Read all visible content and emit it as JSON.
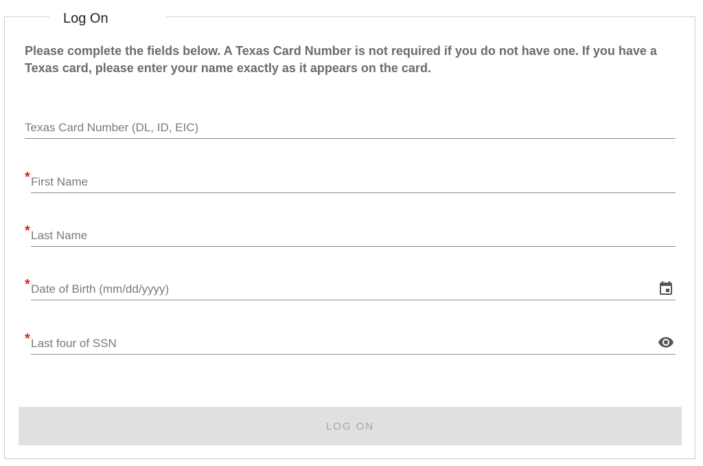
{
  "form": {
    "title": "Log On",
    "intro": "Please complete the fields below. A Texas Card Number is not required if you do not have one. If you have a Texas card, please enter your name exactly as it appears on the card.",
    "required_marker": "*",
    "fields": {
      "card": {
        "placeholder": "Texas Card Number (DL, ID, EIC)",
        "value": ""
      },
      "first_name": {
        "placeholder": "First Name",
        "value": ""
      },
      "last_name": {
        "placeholder": "Last Name",
        "value": ""
      },
      "dob": {
        "placeholder": "Date of Birth (mm/dd/yyyy)",
        "value": ""
      },
      "ssn": {
        "placeholder": "Last four of SSN",
        "value": ""
      }
    },
    "icons": {
      "dob": "calendar-icon",
      "ssn": "eye-icon"
    },
    "submit_label": "LOG ON"
  },
  "colors": {
    "required": "#e0241c",
    "button_bg": "#e0e0e0",
    "button_text": "#a6a6a6"
  }
}
